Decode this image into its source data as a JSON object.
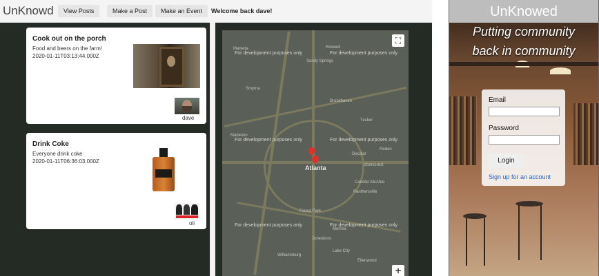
{
  "navbar": {
    "brand": "UnKnowd",
    "links": [
      "View Posts",
      "Make a Post",
      "Make an Event"
    ],
    "welcome": "Welcome back dave!"
  },
  "posts": [
    {
      "title": "Cook out on the porch",
      "description": "Food and beers on the farm!",
      "date": "2020-01-11T03:13:44.000Z",
      "author": "dave",
      "image": "portrait-painting"
    },
    {
      "title": "Drink Coke",
      "description": "Everyone drink coke",
      "date": "2020-01-11T06:36:03.000Z",
      "author": "oli",
      "image": "bottle"
    }
  ],
  "map": {
    "watermark": "For development purposes only",
    "city_label": "Atlanta",
    "labels": [
      "Marietta",
      "Roswell",
      "Sandy Springs",
      "Smyrna",
      "Brookhaven",
      "Mableton",
      "Tucker",
      "Decatur",
      "Redan",
      "Stonecrest",
      "Candler-McAfee",
      "Panthersville",
      "Forest Park",
      "Morrow",
      "Jonesboro",
      "Lake City",
      "Williamsburg",
      "Ellenwood"
    ],
    "fullscreen_icon": "fullscreen-icon",
    "zoom_in_icon": "plus-icon"
  },
  "login_page": {
    "title": "UnKnowed",
    "tagline_line1": "Putting community",
    "tagline_line2": "back in community",
    "email_label": "Email",
    "password_label": "Password",
    "login_button": "Login",
    "signup_link": "Sign up for an account"
  },
  "colors": {
    "left_background": "#242b24",
    "map_background": "#5a5f57",
    "link": "#2a62c9",
    "pin": "#e0302a"
  }
}
